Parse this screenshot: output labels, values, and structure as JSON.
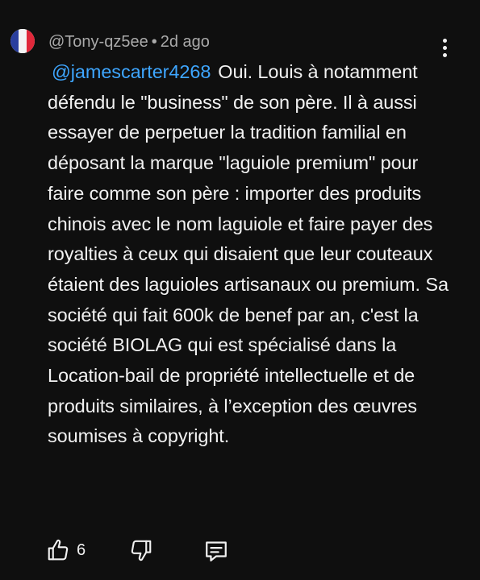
{
  "comment": {
    "author": "@Tony-qz5ee",
    "separator": "•",
    "time": "2d ago",
    "mention": "@jamescarter4268",
    "text": "Oui. Louis à notamment défendu le \"business\" de son père. Il à aussi essayer de perpetuer la tradition familial en déposant la marque \"laguiole premium\" pour faire comme son père : importer des produits chinois avec le nom laguiole et faire payer des royalties à ceux qui disaient que leur couteaux étaient des laguioles artisanaux ou premium. Sa société qui fait 600k de benef par an, c'est la société BIOLAG qui est spécialisé dans la Location-bail de propriété intellectuelle et de produits similaires, à l’exception des œuvres soumises à copyright.",
    "avatar_flag": "france-flag",
    "likes": "6"
  },
  "icons": {
    "more": "more-vertical-icon",
    "like": "thumbs-up-icon",
    "dislike": "thumbs-down-icon",
    "reply": "reply-comment-icon"
  },
  "colors": {
    "background": "#0f0f0f",
    "text": "#f1f1f1",
    "meta": "#aaaaaa",
    "mention": "#3ea6ff"
  }
}
